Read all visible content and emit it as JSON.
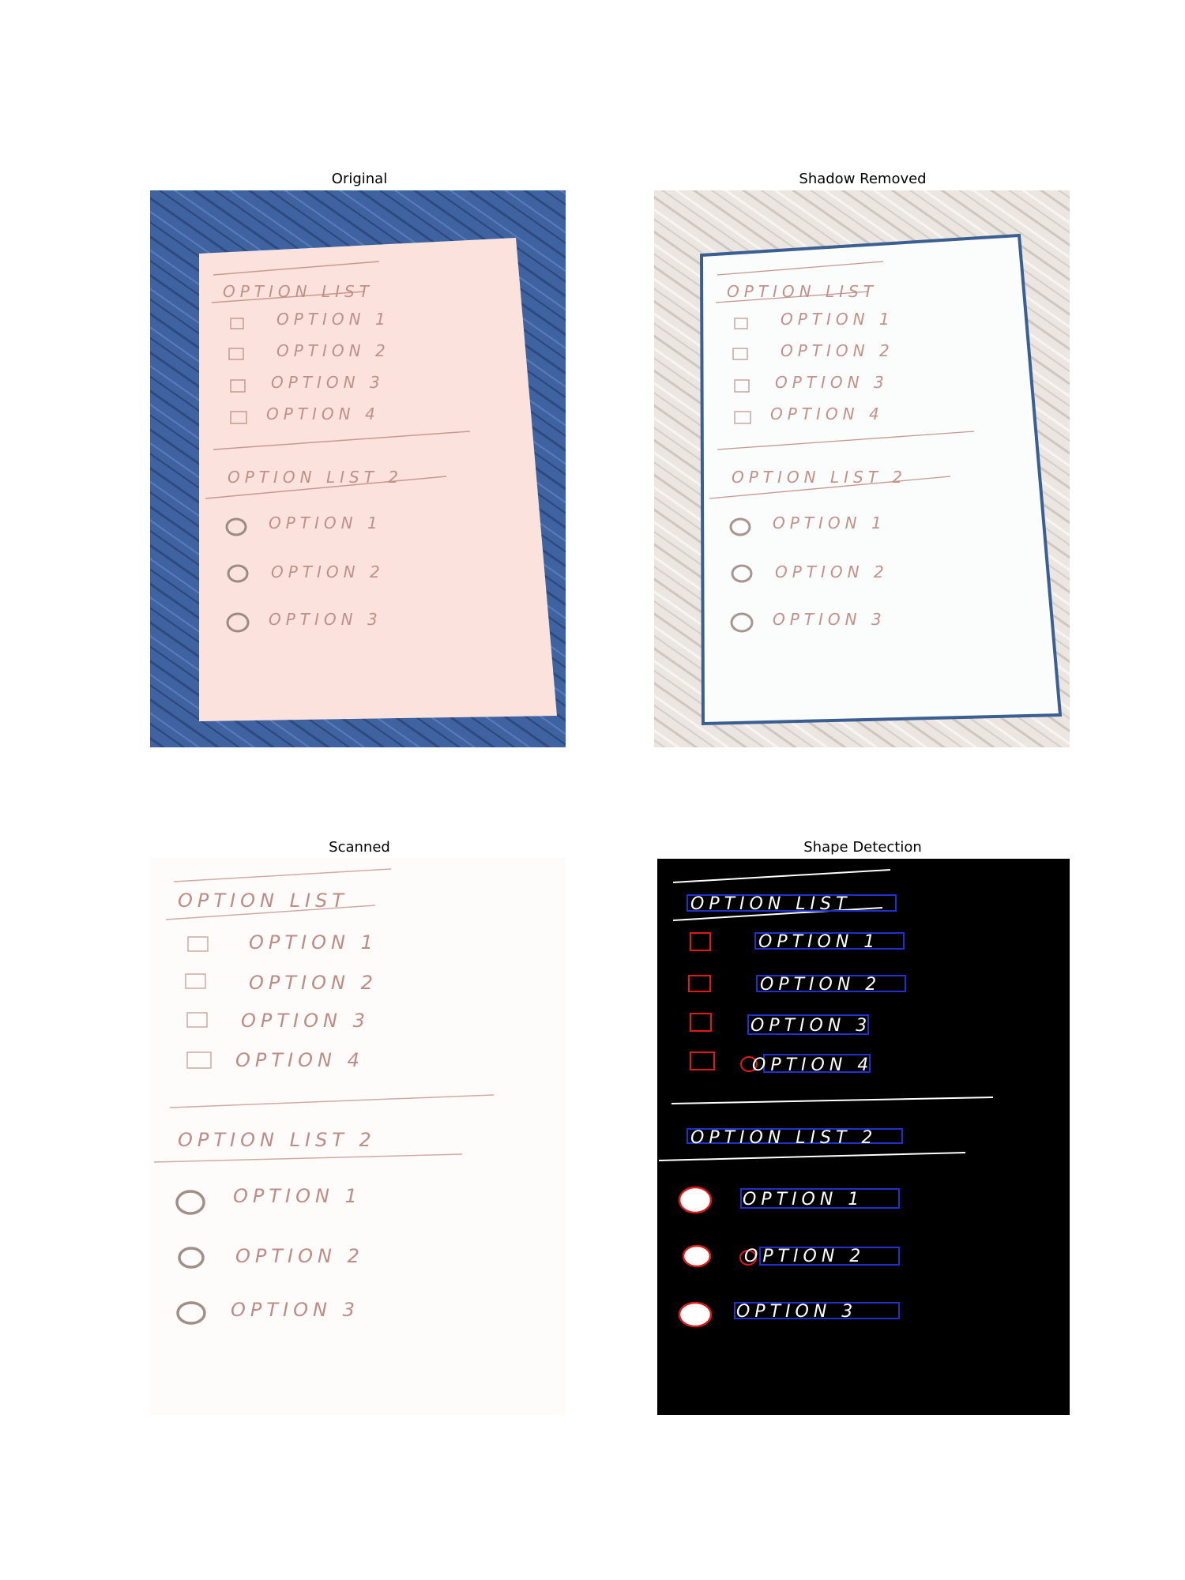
{
  "panels": {
    "original": {
      "title": "Original"
    },
    "shadow": {
      "title": "Shadow Removed"
    },
    "scanned": {
      "title": "Scanned"
    },
    "shape": {
      "title": "Shape Detection"
    }
  },
  "note": {
    "list1_title": "OPTION LIST",
    "list1_items": [
      "OPTION 1",
      "OPTION 2",
      "OPTION 3",
      "OPTION 4"
    ],
    "list2_title": "OPTION LIST 2",
    "list2_items": [
      "OPTION 1",
      "OPTION 2",
      "OPTION 3"
    ]
  },
  "colors": {
    "wood_blue": "#3f63a0",
    "paper_pink": "#fbe2dc",
    "pencil": "#b07a70",
    "detect_box_blue": "#1f2fd0",
    "detect_shape_red": "#e01818"
  }
}
